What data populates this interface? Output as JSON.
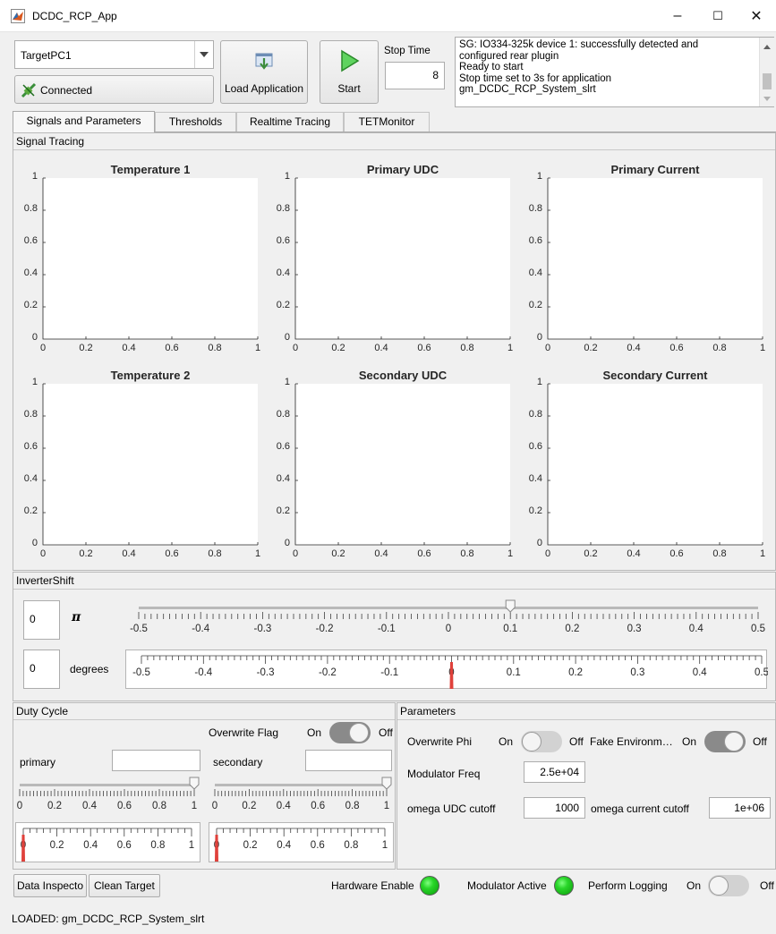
{
  "window": {
    "title": "DCDC_RCP_App",
    "minimize": "–",
    "maximize": "☐",
    "close": "✕"
  },
  "toolbar": {
    "target_value": "TargetPC1",
    "connection_status": "Connected",
    "load_label": "Load Application",
    "start_label": "Start",
    "stop_time_label": "Stop Time",
    "stop_time_value": "8"
  },
  "messages": [
    "SG: IO334-325k device 1: successfully detected and",
    "configured rear plugin",
    "Ready to start",
    "Stop time set to 3s for application",
    "gm_DCDC_RCP_System_slrt"
  ],
  "tabs": [
    "Signals and Parameters",
    "Thresholds",
    "Realtime Tracing",
    "TETMonitor"
  ],
  "signal_tracing": {
    "title": "Signal Tracing",
    "plots": [
      {
        "title": "Temperature 1"
      },
      {
        "title": "Primary UDC"
      },
      {
        "title": "Primary Current"
      },
      {
        "title": "Temperature 2"
      },
      {
        "title": "Secondary UDC"
      },
      {
        "title": "Secondary Current"
      }
    ],
    "x_ticks": [
      "0",
      "0.2",
      "0.4",
      "0.6",
      "0.8",
      "1"
    ],
    "y_ticks": [
      "1",
      "0.8",
      "0.6",
      "0.4",
      "0.2",
      "0"
    ]
  },
  "inverter_shift": {
    "title": "InverterShift",
    "pi_value": "0",
    "pi_label": "π",
    "degrees_value": "0",
    "degrees_label": "degrees",
    "slider_ticks": [
      "-0.5",
      "-0.4",
      "-0.3",
      "-0.2",
      "-0.1",
      "0",
      "0.1",
      "0.2",
      "0.3",
      "0.4",
      "0.5"
    ],
    "slider_value": 0.1,
    "gauge_value": 0
  },
  "duty_cycle": {
    "title": "Duty Cycle",
    "overwrite_flag_label": "Overwrite Flag",
    "on_label": "On",
    "off_label": "Off",
    "primary_label": "primary",
    "secondary_label": "secondary",
    "primary_value": "",
    "secondary_value": "",
    "slider_ticks": [
      "0",
      "0.2",
      "0.4",
      "0.6",
      "0.8",
      "1"
    ],
    "gauge_ticks": [
      "0",
      "0.2",
      "0.4",
      "0.6",
      "0.8",
      "1"
    ],
    "primary_slider": 1,
    "secondary_slider": 1,
    "primary_gauge": 0,
    "secondary_gauge": 0
  },
  "parameters": {
    "title": "Parameters",
    "overwrite_phi_label": "Overwrite Phi",
    "fake_env_label": "Fake Environm…",
    "on_label": "On",
    "off_label": "Off",
    "modulator_freq_label": "Modulator Freq",
    "modulator_freq_value": "2.5e+04",
    "omega_udc_label": "omega UDC cutoff",
    "omega_udc_value": "1000",
    "omega_current_label": "omega current cutoff",
    "omega_current_value": "1e+06"
  },
  "bottom": {
    "data_inspector_label": "Data Inspecto",
    "clean_target_label": "Clean Target",
    "hardware_enable_label": "Hardware Enable",
    "modulator_active_label": "Modulator Active",
    "perform_logging_label": "Perform Logging",
    "on_label": "On",
    "off_label": "Off",
    "status_text": "LOADED: gm_DCDC_RCP_System_slrt"
  },
  "colors": {
    "lamp_on": "#29d629",
    "gauge_needle": "#e0413b"
  }
}
